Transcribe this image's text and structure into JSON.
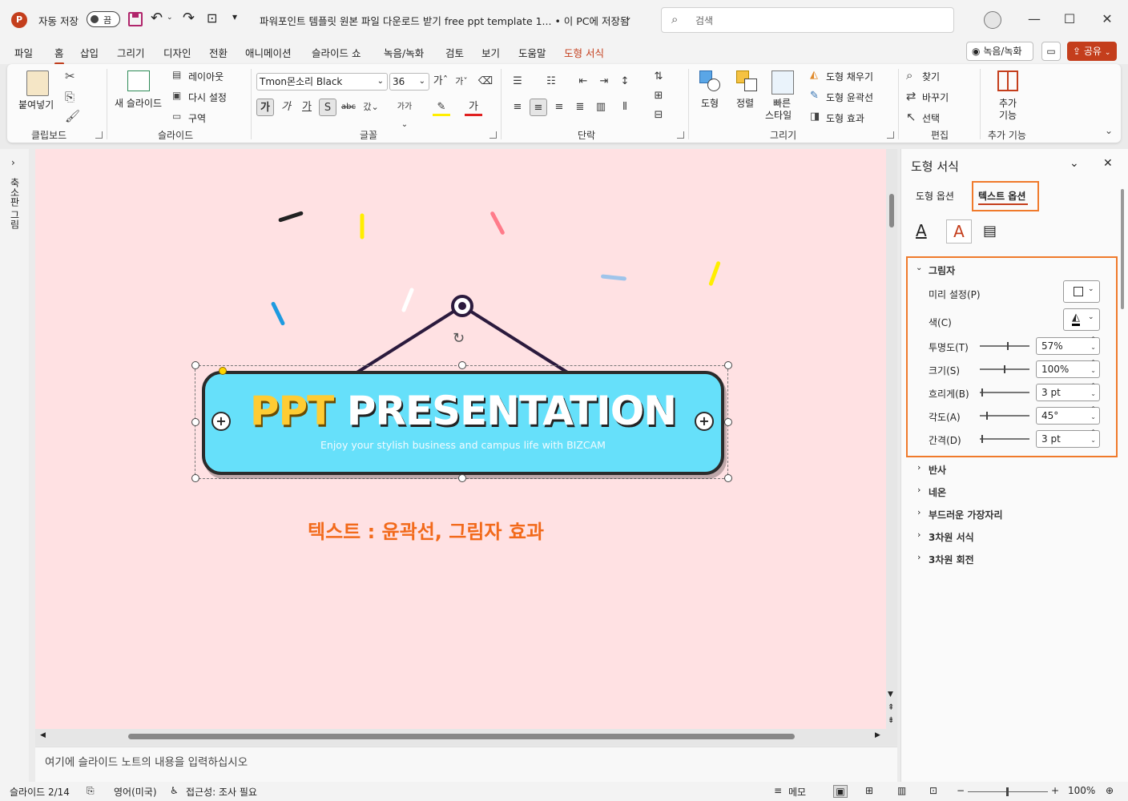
{
  "titlebar": {
    "autosave_label": "자동 저장",
    "autosave_state": "끔",
    "doc_title": "파워포인트 템플릿 원본 파일 다운로드 받기 free ppt template 1... • 이 PC에 저장됨",
    "search_placeholder": "검색"
  },
  "menu": {
    "tabs": [
      "파일",
      "홈",
      "삽입",
      "그리기",
      "디자인",
      "전환",
      "애니메이션",
      "슬라이드 쇼",
      "녹음/녹화",
      "검토",
      "보기",
      "도움말",
      "도형 서식"
    ],
    "record_button": "녹음/녹화",
    "share_button": "공유"
  },
  "ribbon": {
    "clipboard": {
      "paste": "붙여넣기",
      "label": "클립보드"
    },
    "slides": {
      "new_slide": "새 슬라이드",
      "layout": "레이아웃",
      "reset": "다시 설정",
      "section": "구역",
      "label": "슬라이드"
    },
    "font": {
      "family": "Tmon몬소리 Black",
      "size": "36",
      "label": "글꼴"
    },
    "paragraph": {
      "label": "단락"
    },
    "drawing": {
      "shapes": "도형",
      "arrange": "정렬",
      "quick_styles_1": "빠른",
      "quick_styles_2": "스타일",
      "fill": "도형 채우기",
      "outline": "도형 윤곽선",
      "effects": "도형 효과",
      "label": "그리기"
    },
    "editing": {
      "find": "찾기",
      "replace": "바꾸기",
      "select": "선택",
      "label": "편집"
    },
    "addins": {
      "button_1": "추가",
      "button_2": "기능",
      "label": "추가 기능"
    }
  },
  "thumb_strip": {
    "label": "축소판 그림"
  },
  "slide": {
    "title_part1": "PPT",
    "title_part2": "PRESENTATION",
    "subtitle": "Enjoy your stylish business and campus life with BIZCAM",
    "caption": "텍스트 : 윤곽선, 그림자 효과"
  },
  "notes": {
    "placeholder": "여기에 슬라이드 노트의 내용을 입력하십시오"
  },
  "pane": {
    "title": "도형 서식",
    "tab_shape": "도형 옵션",
    "tab_text": "텍스트 옵션",
    "shadow": {
      "section": "그림자",
      "preset": "미리 설정(P)",
      "color": "색(C)",
      "transparency_label": "투명도(T)",
      "transparency_value": "57%",
      "transparency_fraction": 0.57,
      "size_label": "크기(S)",
      "size_value": "100%",
      "size_fraction": 0.5,
      "blur_label": "흐리게(B)",
      "blur_value": "3 pt",
      "blur_fraction": 0.03,
      "angle_label": "각도(A)",
      "angle_value": "45°",
      "angle_fraction": 0.125,
      "distance_label": "간격(D)",
      "distance_value": "3 pt",
      "distance_fraction": 0.03
    },
    "sections": [
      "반사",
      "네온",
      "부드러운 가장자리",
      "3차원 서식",
      "3차원 회전"
    ]
  },
  "status": {
    "slide_info": "슬라이드 2/14",
    "language": "영어(미국)",
    "accessibility": "접근성: 조사 필요",
    "notes_button": "메모",
    "zoom": "100%"
  },
  "colors": {
    "accent": "#c43e1c",
    "highlight_border": "#f07a2b",
    "slide_bg": "#ffe1e3",
    "banner_fill": "#66e0fa",
    "title_yellow": "#ffcc33",
    "caption_orange": "#f26a1b"
  }
}
